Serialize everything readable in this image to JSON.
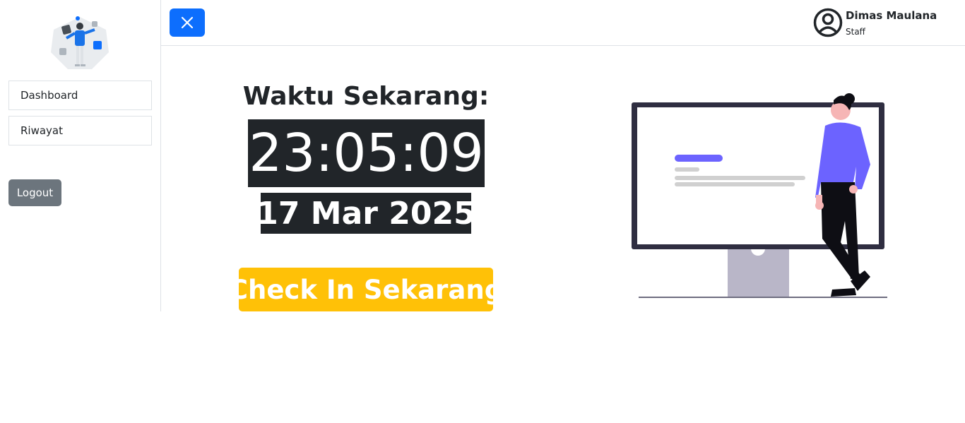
{
  "sidebar": {
    "items": [
      {
        "label": "Dashboard"
      },
      {
        "label": "Riwayat"
      }
    ],
    "logout_label": "Logout"
  },
  "header": {
    "close_icon": "close-icon",
    "user": {
      "name": "Dimas Maulana",
      "role": "Staff",
      "avatar_icon": "user-circle-icon"
    }
  },
  "main": {
    "time_title": "Waktu Sekarang:",
    "clock": "23:05:09",
    "date": "17 Mar 2025",
    "checkin_label": "Check In Sekarang"
  },
  "colors": {
    "primary": "#0d6efd",
    "secondary": "#6c757d",
    "warning": "#ffc107",
    "dark": "#212529",
    "accent_purple": "#6c63ff"
  }
}
